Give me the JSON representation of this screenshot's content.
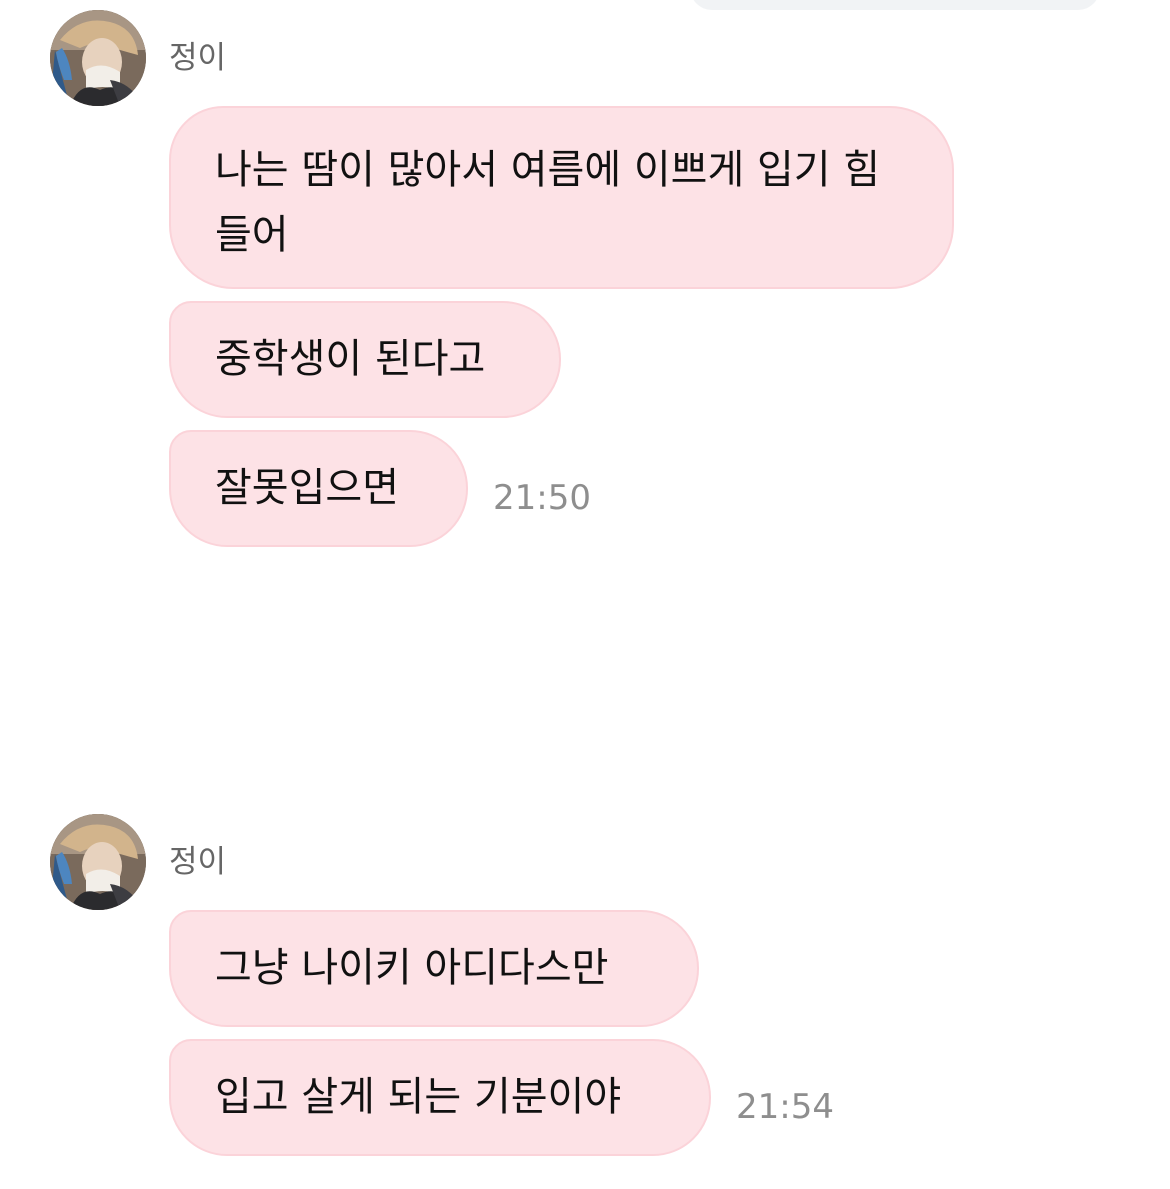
{
  "group1": {
    "sender_name": "정이",
    "messages": [
      "나는 땀이 많아서 여름에 이쁘게 입기 힘들어",
      "중학생이 된다고",
      "잘못입으면"
    ],
    "timestamp": "21:50"
  },
  "group2": {
    "sender_name": "정이",
    "messages": [
      "그냥 나이키 아디다스만",
      "입고 살게 되는 기분이야"
    ],
    "timestamp": "21:54"
  },
  "colors": {
    "bubble_fill": "#fde2e6",
    "bubble_border": "#fbd3d9",
    "timestamp": "#8e8e8e",
    "sender_name": "#666666"
  }
}
